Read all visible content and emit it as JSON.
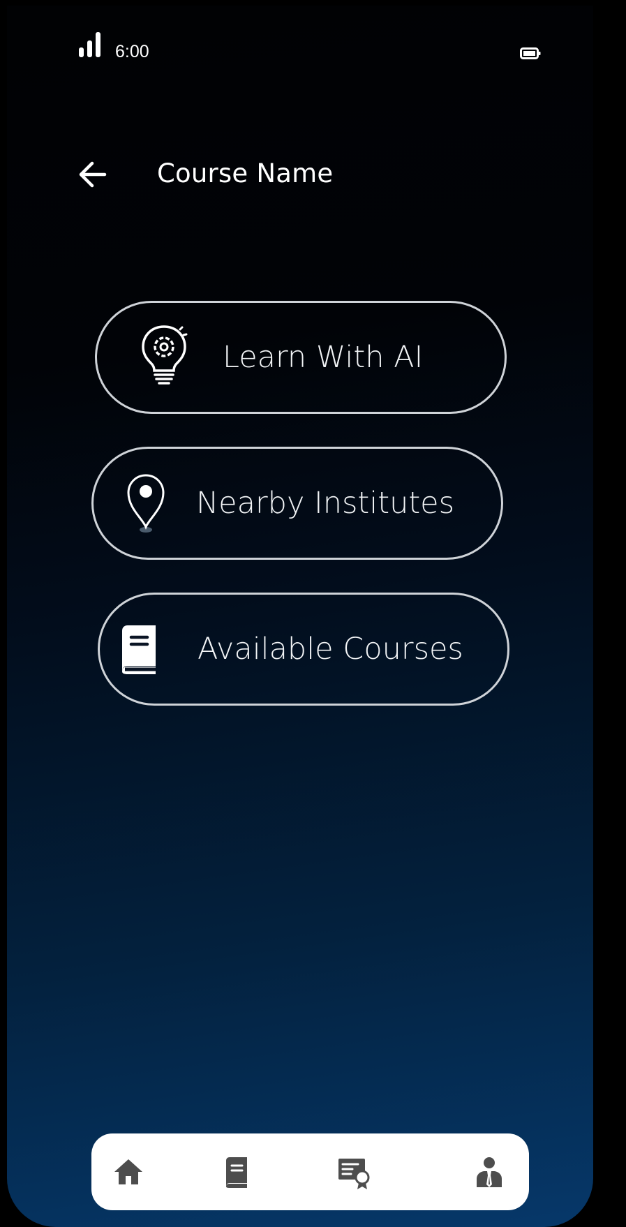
{
  "status_bar": {
    "time": "6:00",
    "signal_icon": "cellular-signal-icon",
    "battery_icon": "battery-icon"
  },
  "header": {
    "back_icon": "arrow-left-icon",
    "title": "Course Name"
  },
  "options": [
    {
      "label": "Learn With AI",
      "icon": "lightbulb-gear-icon"
    },
    {
      "label": "Nearby Institutes",
      "icon": "map-pin-icon"
    },
    {
      "label": "Available Courses",
      "icon": "book-icon"
    }
  ],
  "bottom_nav": {
    "items": [
      {
        "icon": "home-icon"
      },
      {
        "icon": "book-icon"
      },
      {
        "icon": "certificate-icon"
      },
      {
        "icon": "profile-icon"
      }
    ]
  },
  "colors": {
    "background_top": "#010204",
    "background_bottom": "#06386a",
    "text": "#ffffff",
    "button_border": "#cfd3d8",
    "nav_background": "#ffffff",
    "nav_icon": "#4d4d4d"
  }
}
